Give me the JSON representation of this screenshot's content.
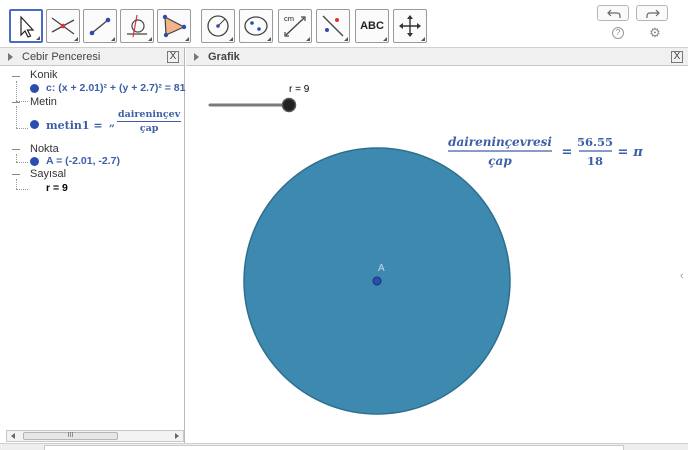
{
  "toolbar": {
    "tools": [
      {
        "icon": "move-arrow-icon",
        "selected": true
      },
      {
        "icon": "intersect-lines-icon"
      },
      {
        "icon": "segment-icon"
      },
      {
        "icon": "perpendicular-circle-icon"
      },
      {
        "icon": "polygon-icon"
      },
      {
        "icon": "circle-center-point-icon"
      },
      {
        "icon": "ellipse-icon"
      },
      {
        "icon": "distance-cm-icon"
      },
      {
        "icon": "reflect-line-icon"
      },
      {
        "icon": "text-icon"
      },
      {
        "icon": "move-view-icon"
      }
    ],
    "text_tool_label": "ABC",
    "distance_tool_label": "cm",
    "undo_icon": "undo-icon",
    "redo_icon": "redo-icon",
    "help_label": "?",
    "settings_icon": "gear-icon"
  },
  "algebra": {
    "title": "Cebir Penceresi",
    "close_label": "X",
    "categories": [
      {
        "name": "Konik",
        "object": "c: (x + 2.01)² + (y + 2.7)² = 81"
      },
      {
        "name": "Metin",
        "object_label": "metin1 =",
        "object_prefix": "„",
        "frac_num": "daireninçev",
        "frac_den": "çap"
      },
      {
        "name": "Nokta",
        "object": "A = (-2.01, -2.7)"
      },
      {
        "name": "Sayısal",
        "object": "r = 9"
      }
    ],
    "scroll_thumb": "III"
  },
  "graphics": {
    "title": "Grafik",
    "close_label": "X",
    "slider_label": "r = 9",
    "slider_value": 9,
    "point_label": "A",
    "formula": {
      "num1": "daireninçevresi",
      "den1": "çap",
      "eq": "=",
      "num2": "56.55",
      "den2": "18",
      "eq2": "=",
      "rhs": "π"
    },
    "circle_fill": "#3d89b0",
    "circle_stroke": "#2e6f90",
    "point_color": "#2b4db0"
  }
}
